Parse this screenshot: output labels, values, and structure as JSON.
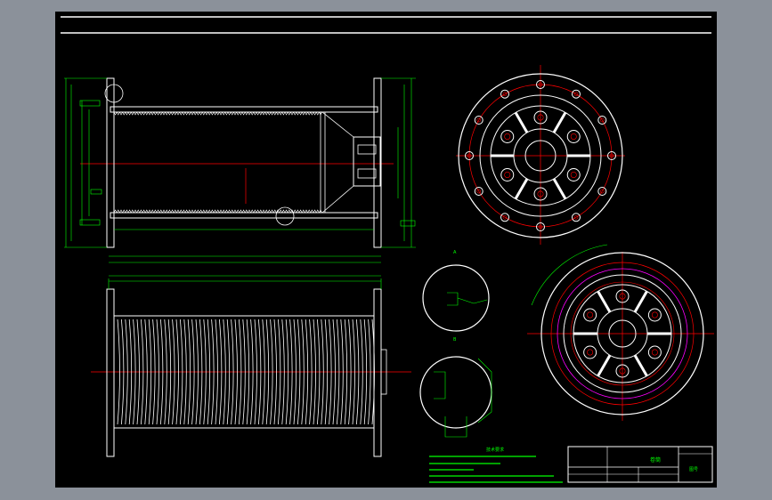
{
  "colors": {
    "background": "#8b919a",
    "sheet": "#000000",
    "outline": "#ffffff",
    "dimension": "#00ff00",
    "centerline": "#ff0000",
    "accent": "#ff00ff"
  },
  "title_block": {
    "title": "卷筒",
    "sheet_label": "图号"
  },
  "tech_requirements": {
    "heading": "技术要求"
  },
  "section_marks": {
    "section_a": "A",
    "section_b": "B"
  }
}
